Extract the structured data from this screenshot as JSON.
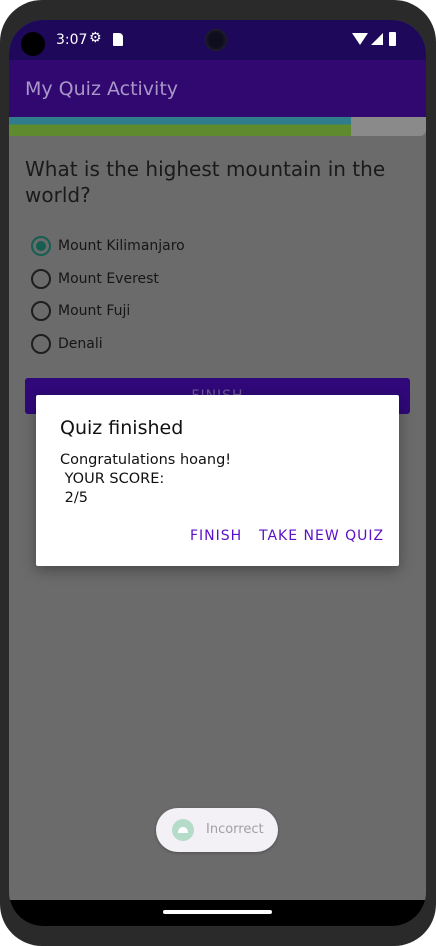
{
  "status_bar": {
    "time": "3:07",
    "icons": [
      "settings-icon",
      "sd-card-icon",
      "wifi-icon",
      "signal-icon",
      "battery-icon"
    ]
  },
  "app_bar": {
    "title": "My Quiz Activity"
  },
  "progress": {
    "value": 0.82,
    "accent": "#5f8a2e"
  },
  "question": {
    "text": "What is the highest mountain in the world?",
    "options": [
      {
        "label": "Mount Kilimanjaro",
        "selected": true
      },
      {
        "label": "Mount Everest",
        "selected": false
      },
      {
        "label": "Mount Fuji",
        "selected": false
      },
      {
        "label": "Denali",
        "selected": false
      }
    ]
  },
  "main_button": {
    "label": "FINISH"
  },
  "dialog": {
    "title": "Quiz finished",
    "message": "Congratulations hoang!\n YOUR SCORE:\n 2/5",
    "finish_label": "FINISH",
    "new_quiz_label": "TAKE NEW QUIZ"
  },
  "toast": {
    "text": "Incorrect",
    "icon": "android-icon"
  },
  "colors": {
    "primary": "#30087a",
    "dialog_button": "#5b10c8",
    "radio_checked": "#155f52"
  }
}
